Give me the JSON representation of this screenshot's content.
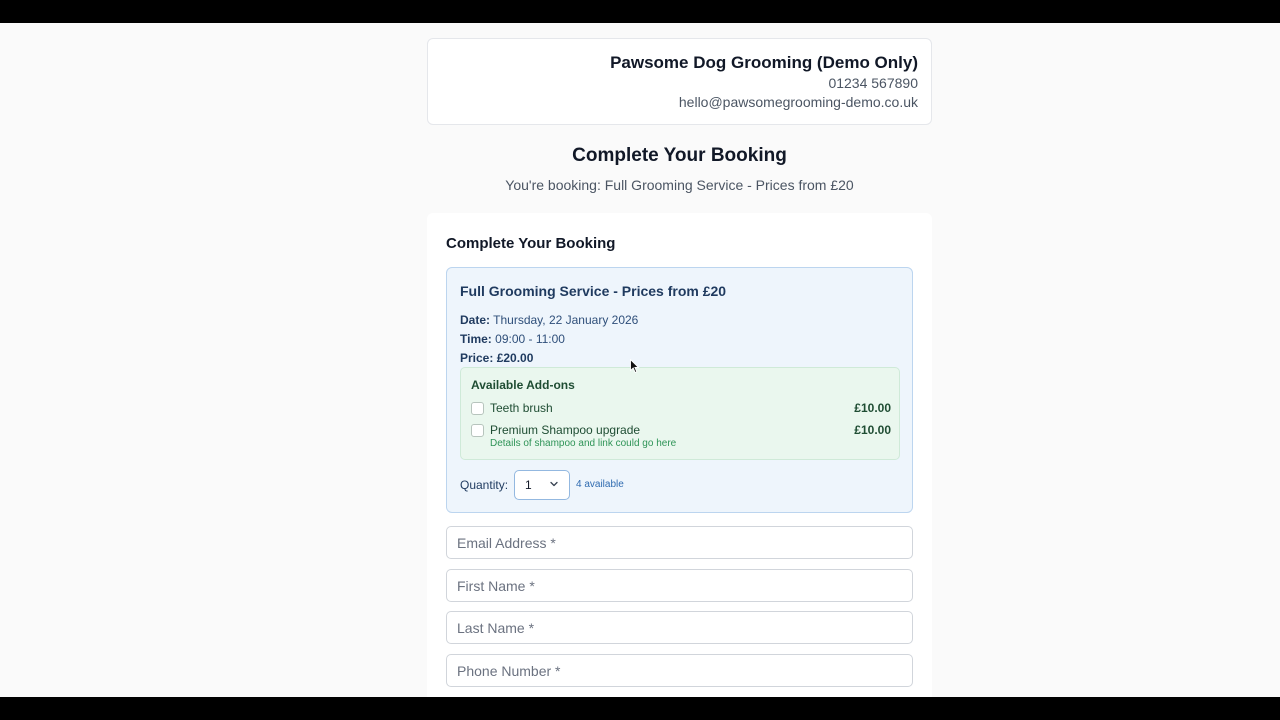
{
  "business": {
    "name": "Pawsome Dog Grooming (Demo Only)",
    "phone": "01234 567890",
    "email": "hello@pawsomegrooming-demo.co.uk"
  },
  "page": {
    "title": "Complete Your Booking",
    "subtitle": "You're booking: Full Grooming Service - Prices from £20"
  },
  "form": {
    "heading": "Complete Your Booking",
    "service": {
      "title": "Full Grooming Service - Prices from £20",
      "date_label": "Date:",
      "date_value": "Thursday, 22 January 2026",
      "time_label": "Time:",
      "time_value": "09:00 - 11:00",
      "price_label": "Price:",
      "price_value": "£20.00"
    },
    "addons": {
      "title": "Available Add-ons",
      "items": [
        {
          "name": "Teeth brush",
          "price": "£10.00",
          "checked": false
        },
        {
          "name": "Premium Shampoo upgrade",
          "price": "£10.00",
          "checked": false,
          "description": "Details of shampoo and link could go here"
        }
      ]
    },
    "quantity": {
      "label": "Quantity:",
      "value": "1",
      "available": "4 available"
    },
    "fields": {
      "email_placeholder": "Email Address *",
      "first_name_placeholder": "First Name *",
      "last_name_placeholder": "Last Name *",
      "phone_placeholder": "Phone Number *"
    }
  },
  "colors": {
    "service_bg": "#eef5fc",
    "addons_bg": "#eaf7ee",
    "accent_blue": "#2f6bb0"
  }
}
